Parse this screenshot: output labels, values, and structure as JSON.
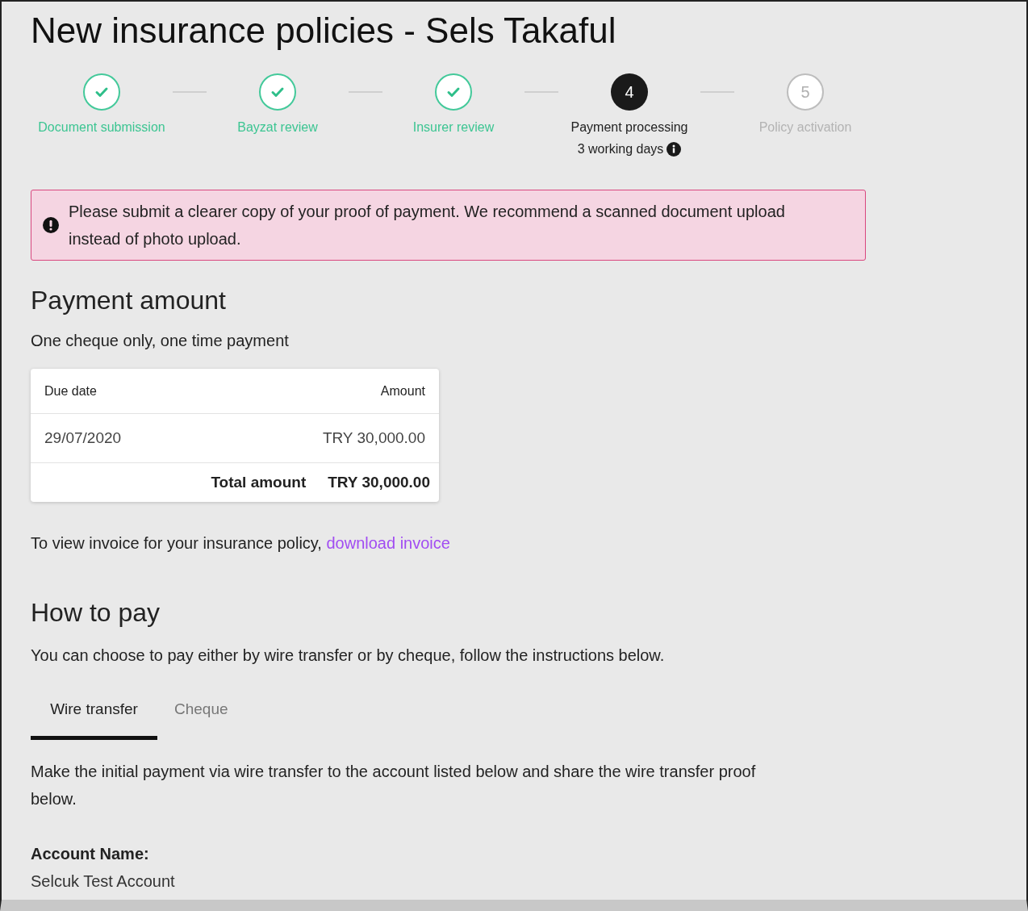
{
  "title": "New insurance policies - Sels Takaful",
  "steps": [
    {
      "label": "Document submission",
      "kind": "done"
    },
    {
      "label": "Bayzat review",
      "kind": "done"
    },
    {
      "label": "Insurer review",
      "kind": "done"
    },
    {
      "label": "Payment processing",
      "kind": "current",
      "number": "4",
      "note": "3 working days"
    },
    {
      "label": "Policy activation",
      "kind": "upcoming",
      "number": "5"
    }
  ],
  "alert": {
    "text": "Please submit a clearer copy of your proof of payment. We recommend a scanned document upload instead of photo upload."
  },
  "payment_amount": {
    "heading": "Payment amount",
    "subtitle": "One cheque only, one time payment",
    "table": {
      "columns": [
        "Due date",
        "Amount"
      ],
      "rows": [
        [
          "29/07/2020",
          "TRY 30,000.00"
        ]
      ],
      "total_label": "Total amount",
      "total_value": "TRY 30,000.00"
    },
    "invoice_text": "To view invoice for your insurance policy,",
    "invoice_link": "download invoice"
  },
  "how_to_pay": {
    "heading": "How to pay",
    "intro": "You can choose to pay either by wire transfer or by cheque, follow the instructions below.",
    "tabs": [
      {
        "label": "Wire transfer",
        "selected": true
      },
      {
        "label": "Cheque",
        "selected": false
      }
    ],
    "instructions": "Make the initial payment via wire transfer to the account listed below and share the wire transfer proof below.",
    "account_label": "Account Name:",
    "account_value": "Selcuk Test Account"
  }
}
